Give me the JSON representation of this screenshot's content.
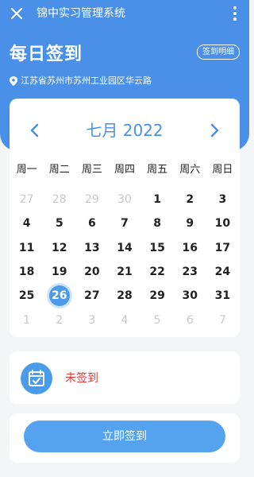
{
  "topbar": {
    "title": "锦中实习管理系统"
  },
  "page": {
    "title": "每日签到",
    "detail_button": "签到明细"
  },
  "location": {
    "text": "江苏省苏州市苏州工业园区华云路"
  },
  "calendar": {
    "month_label": "七月 2022",
    "weekdays": [
      "周一",
      "周二",
      "周三",
      "周四",
      "周五",
      "周六",
      "周日"
    ],
    "days": [
      {
        "d": "27",
        "muted": true
      },
      {
        "d": "28",
        "muted": true
      },
      {
        "d": "29",
        "muted": true
      },
      {
        "d": "30",
        "muted": true
      },
      {
        "d": "1"
      },
      {
        "d": "2"
      },
      {
        "d": "3"
      },
      {
        "d": "4"
      },
      {
        "d": "5"
      },
      {
        "d": "6"
      },
      {
        "d": "7"
      },
      {
        "d": "8"
      },
      {
        "d": "9"
      },
      {
        "d": "10"
      },
      {
        "d": "11"
      },
      {
        "d": "12"
      },
      {
        "d": "13"
      },
      {
        "d": "14"
      },
      {
        "d": "15"
      },
      {
        "d": "16"
      },
      {
        "d": "17"
      },
      {
        "d": "18"
      },
      {
        "d": "19"
      },
      {
        "d": "20"
      },
      {
        "d": "21"
      },
      {
        "d": "22"
      },
      {
        "d": "23"
      },
      {
        "d": "24"
      },
      {
        "d": "25"
      },
      {
        "d": "26",
        "today": true
      },
      {
        "d": "27"
      },
      {
        "d": "28"
      },
      {
        "d": "29"
      },
      {
        "d": "30"
      },
      {
        "d": "31"
      },
      {
        "d": "1",
        "muted": true
      },
      {
        "d": "2",
        "muted": true
      },
      {
        "d": "3",
        "muted": true
      },
      {
        "d": "4",
        "muted": true
      },
      {
        "d": "5",
        "muted": true
      },
      {
        "d": "6",
        "muted": true
      },
      {
        "d": "7",
        "muted": true
      }
    ]
  },
  "status": {
    "text": "未签到",
    "icon": "calendar-check-icon"
  },
  "action": {
    "checkin_label": "立即签到"
  },
  "colors": {
    "primary": "#4a90e8",
    "today": "#4a9be8",
    "status_red": "#e53935"
  }
}
